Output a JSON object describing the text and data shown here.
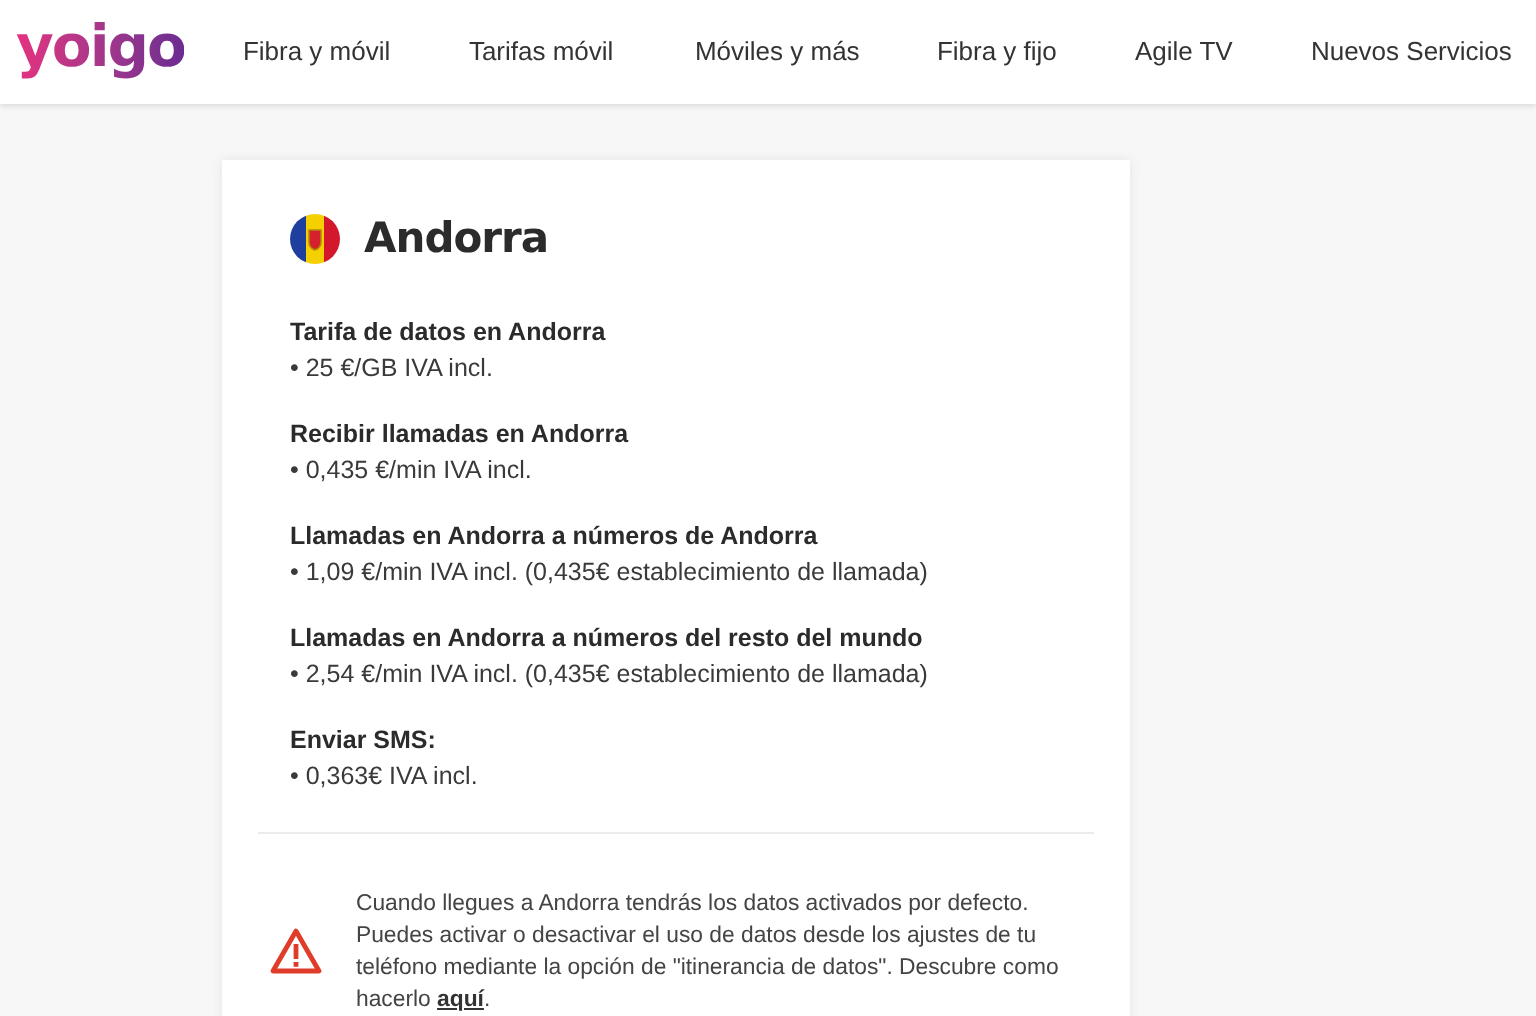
{
  "header": {
    "logo": "yoigo",
    "nav": [
      {
        "label": "Fibra y móvil"
      },
      {
        "label": "Tarifas móvil"
      },
      {
        "label": "Móviles y más"
      },
      {
        "label": "Fibra y fijo"
      },
      {
        "label": "Agile TV"
      },
      {
        "label": "Nuevos Servicios"
      }
    ]
  },
  "card": {
    "title": "Andorra",
    "sections": [
      {
        "heading": "Tarifa de datos en Andorra",
        "detail": "• 25 €/GB IVA incl."
      },
      {
        "heading": "Recibir llamadas en Andorra",
        "detail": "• 0,435 €/min IVA incl."
      },
      {
        "heading": "Llamadas en Andorra a números de Andorra",
        "detail": "• 1,09 €/min IVA incl. (0,435€ establecimiento de llamada)"
      },
      {
        "heading": "Llamadas en Andorra a números del resto del mundo",
        "detail": "• 2,54 €/min IVA incl. (0,435€ establecimiento de llamada)"
      },
      {
        "heading": "Enviar SMS:",
        "detail": "• 0,363€ IVA incl."
      }
    ],
    "notice": {
      "text": "Cuando llegues a Andorra tendrás los datos activados por defecto. Puedes activar o desactivar el uso de datos desde los ajustes de tu teléfono mediante la opción de \"itinerancia de datos\". Descubre como hacerlo ",
      "link": "aquí",
      "end": "."
    }
  }
}
